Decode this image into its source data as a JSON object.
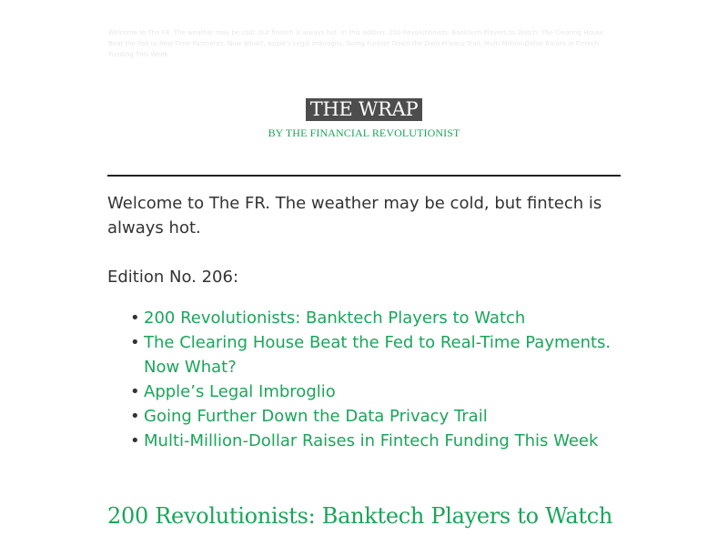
{
  "preheader": "Welcome to The FR. The weather may be cold, but fintech is always hot. In this edition: 200 Revolutionists: Banktech Players to Watch; The Clearing House Beat the Fed to Real-Time Payments. Now What?; Apple's Legal Imbroglio; Going Further Down the Data Privacy Trail; Multi-Million-Dollar Raises in Fintech Funding This Week",
  "masthead": {
    "title": "THE WRAP",
    "byline": "BY THE FINANCIAL REVOLUTIONIST"
  },
  "content": {
    "intro": "Welcome to The FR. The weather may be cold, but fintech is always hot.",
    "edition": "Edition No. 206:",
    "bullet_glyph": "•",
    "toc": [
      {
        "label": "200 Revolutionists: Banktech Players to Watch"
      },
      {
        "label": "The Clearing House Beat the Fed to Real-Time Payments. Now What?"
      },
      {
        "label": "Apple’s Legal Imbroglio"
      },
      {
        "label": "Going Further Down the Data Privacy Trail"
      },
      {
        "label": "Multi-Million-Dollar Raises in Fintech Funding This Week"
      }
    ],
    "section_heading": "200 Revolutionists: Banktech Players to Watch"
  },
  "colors": {
    "accent": "#1aa55a",
    "title_bg": "#4d4d4d",
    "text": "#333333",
    "rule": "#222222"
  }
}
